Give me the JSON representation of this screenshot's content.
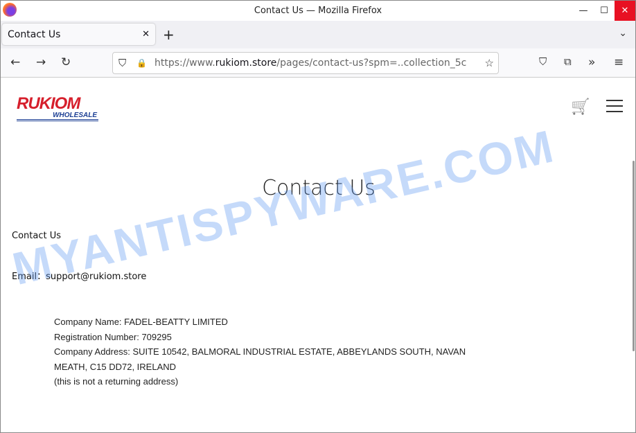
{
  "window": {
    "title": "Contact Us — Mozilla Firefox",
    "minimize": "—",
    "maximize": "☐",
    "close": "✕"
  },
  "tab": {
    "label": "Contact Us",
    "close": "✕",
    "new": "+",
    "list": "⌄"
  },
  "nav": {
    "back": "←",
    "forward": "→",
    "reload": "↻",
    "url_prefix": "https://www.",
    "url_domain": "rukiom.store",
    "url_path": "/pages/contact-us?spm=..collection_5c",
    "shield": "⛉",
    "lock": "🔒",
    "star": "☆",
    "pocket": "⛉",
    "extensions": "⧉",
    "overflow": "»",
    "menu": "≡"
  },
  "site": {
    "logo_main": "RUKIOM",
    "logo_sub": "WHOLESALE",
    "cart": "🛒"
  },
  "content": {
    "title": "Contact Us",
    "subtitle": "Contact Us",
    "email": "Email：support@rukiom.store",
    "company_lines": [
      "Company Name: FADEL-BEATTY LIMITED",
      "Registration Number: 709295",
      "Company Address: SUITE 10542, BALMORAL INDUSTRIAL ESTATE, ABBEYLANDS SOUTH, NAVAN",
      "MEATH, C15 DD72, IRELAND",
      "(this is not a returning address)"
    ]
  },
  "watermark": "MYANTISPYWARE.COM"
}
